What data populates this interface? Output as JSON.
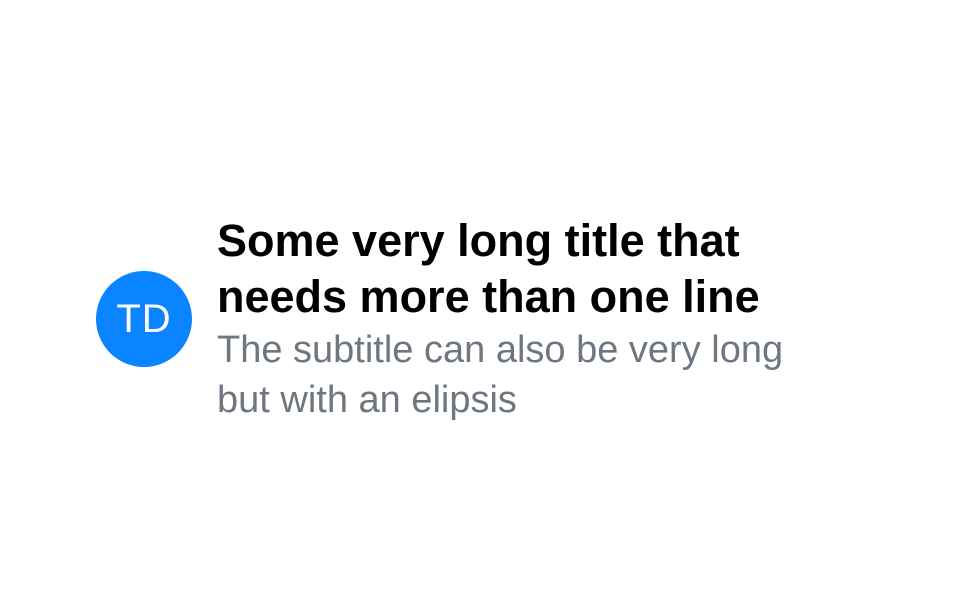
{
  "item": {
    "avatar": {
      "initials": "TD",
      "color": "#0a84ff"
    },
    "title": "Some very long title that needs more than one line",
    "subtitle": "The subtitle can also be very long but with an elipsis"
  },
  "colors": {
    "title": "#000000",
    "subtitle": "#6e7780",
    "background": "#ffffff"
  }
}
